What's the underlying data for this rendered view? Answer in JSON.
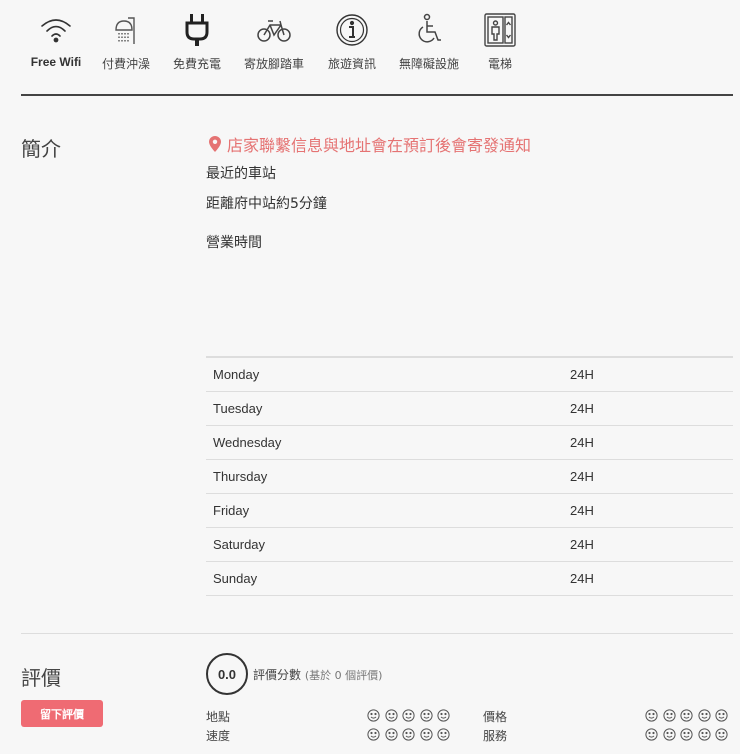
{
  "amenities": [
    {
      "icon": "wifi-icon",
      "label": "Free Wifi"
    },
    {
      "icon": "shower-icon",
      "label": "付費沖澡"
    },
    {
      "icon": "plug-icon",
      "label": "免費充電"
    },
    {
      "icon": "bicycle-icon",
      "label": "寄放腳踏車"
    },
    {
      "icon": "info-icon",
      "label": "旅遊資訊"
    },
    {
      "icon": "wheelchair-icon",
      "label": "無障礙設施"
    },
    {
      "icon": "elevator-icon",
      "label": "電梯"
    }
  ],
  "intro": {
    "title": "簡介",
    "notice": "店家聯繫信息與地址會在預訂後會寄發通知",
    "nearest_station_label": "最近的車站",
    "distance": "距離府中站約5分鐘",
    "hours_label": "營業時間",
    "notice_color": "#e57373"
  },
  "hours": [
    {
      "day": "Monday",
      "value": "24H"
    },
    {
      "day": "Tuesday",
      "value": "24H"
    },
    {
      "day": "Wednesday",
      "value": "24H"
    },
    {
      "day": "Thursday",
      "value": "24H"
    },
    {
      "day": "Friday",
      "value": "24H"
    },
    {
      "day": "Saturday",
      "value": "24H"
    },
    {
      "day": "Sunday",
      "value": "24H"
    }
  ],
  "reviews": {
    "title": "評價",
    "button_label": "留下評價",
    "button_color": "#ef6b73",
    "score": "0.0",
    "score_label": "評價分數",
    "score_sub": "(基於 0 個評價)",
    "categories": [
      {
        "label": "地點",
        "rating": 0
      },
      {
        "label": "價格",
        "rating": 0
      },
      {
        "label": "速度",
        "rating": 0
      },
      {
        "label": "服務",
        "rating": 0
      }
    ]
  }
}
